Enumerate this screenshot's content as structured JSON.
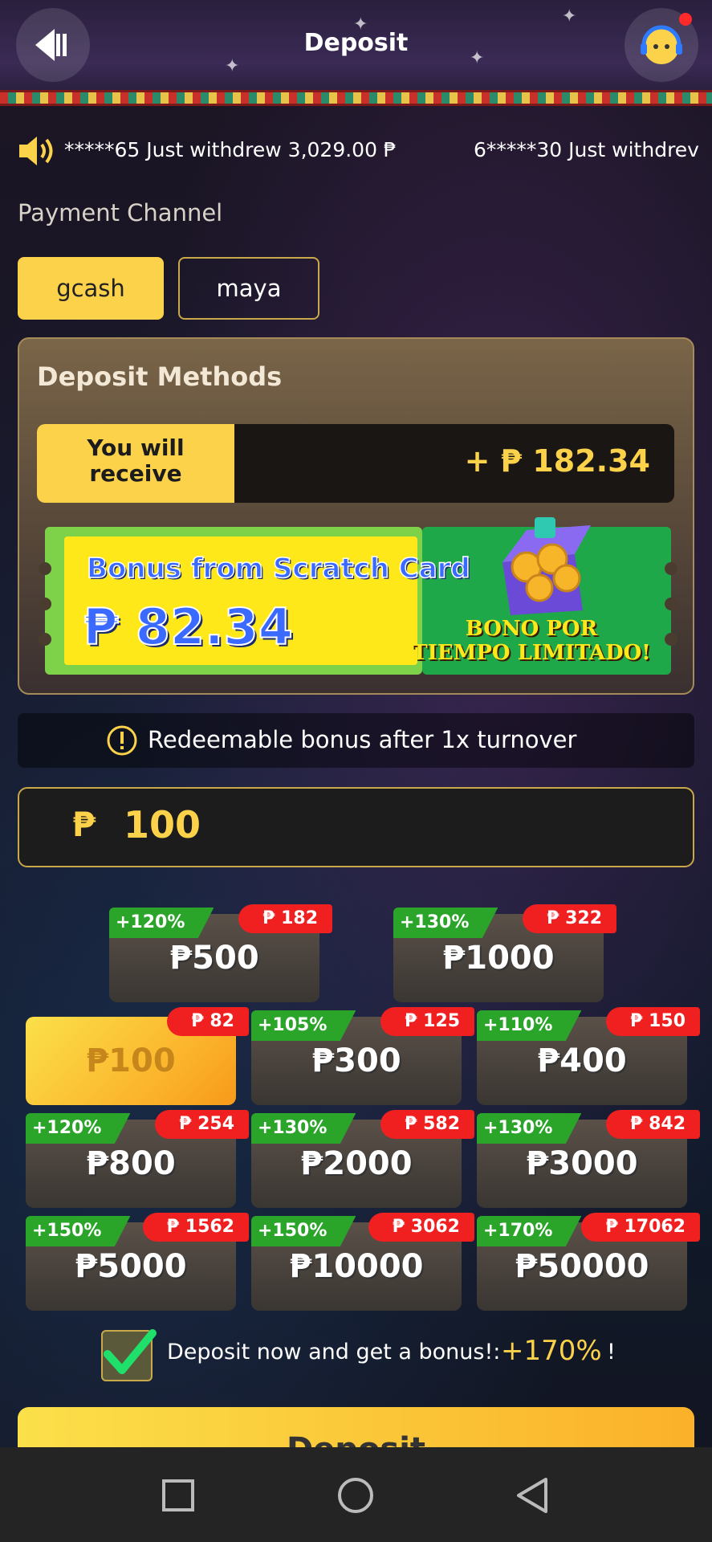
{
  "header": {
    "title": "Deposit"
  },
  "marquee": {
    "items": [
      "*****65 Just withdrew 3,029.00 ₱",
      "6*****30 Just withdrev"
    ]
  },
  "payment_channel": {
    "title": "Payment Channel",
    "options": [
      {
        "label": "gcash",
        "selected": true
      },
      {
        "label": "maya",
        "selected": false
      }
    ]
  },
  "deposit_methods": {
    "title": "Deposit Methods",
    "receive_label": "You will receive",
    "receive_value": "+ ₱ 182.34"
  },
  "scratch_card": {
    "title": "Bonus from Scratch Card",
    "value": "₱ 82.34",
    "promo_line1": "BONO POR",
    "promo_line2": "TIEMPO LIMITADO!"
  },
  "turnover_note": "Redeemable bonus after 1x turnover",
  "amount_input": {
    "currency": "₱",
    "value": "100"
  },
  "amount_cards": [
    {
      "amount": "₱500",
      "pct": "+120%",
      "bonus": "₱ 182",
      "selected": false
    },
    {
      "amount": "₱1000",
      "pct": "+130%",
      "bonus": "₱ 322",
      "selected": false
    },
    {
      "amount": "₱100",
      "pct": "",
      "bonus": "₱ 82",
      "selected": true
    },
    {
      "amount": "₱300",
      "pct": "+105%",
      "bonus": "₱ 125",
      "selected": false
    },
    {
      "amount": "₱400",
      "pct": "+110%",
      "bonus": "₱ 150",
      "selected": false
    },
    {
      "amount": "₱800",
      "pct": "+120%",
      "bonus": "₱ 254",
      "selected": false
    },
    {
      "amount": "₱2000",
      "pct": "+130%",
      "bonus": "₱ 582",
      "selected": false
    },
    {
      "amount": "₱3000",
      "pct": "+130%",
      "bonus": "₱ 842",
      "selected": false
    },
    {
      "amount": "₱5000",
      "pct": "+150%",
      "bonus": "₱ 1562",
      "selected": false
    },
    {
      "amount": "₱10000",
      "pct": "+150%",
      "bonus": "₱ 3062",
      "selected": false
    },
    {
      "amount": "₱50000",
      "pct": "+170%",
      "bonus": "₱ 17062",
      "selected": false
    }
  ],
  "bonus_opt_in": {
    "checked": true,
    "text": "Deposit now and get a bonus!:",
    "percent": "+170%",
    "suffix": "!"
  },
  "deposit_button": {
    "label": "Deposit"
  },
  "colors": {
    "accent": "#fbd24a",
    "pct_green": "#2aa52a",
    "bonus_red": "#f02020"
  },
  "icons": {
    "back": "back-arrow-icon",
    "support": "support-agent-icon",
    "speaker": "speaker-icon",
    "alert": "alert-icon",
    "check": "checkmark-icon",
    "chest": "treasure-chest-icon"
  }
}
